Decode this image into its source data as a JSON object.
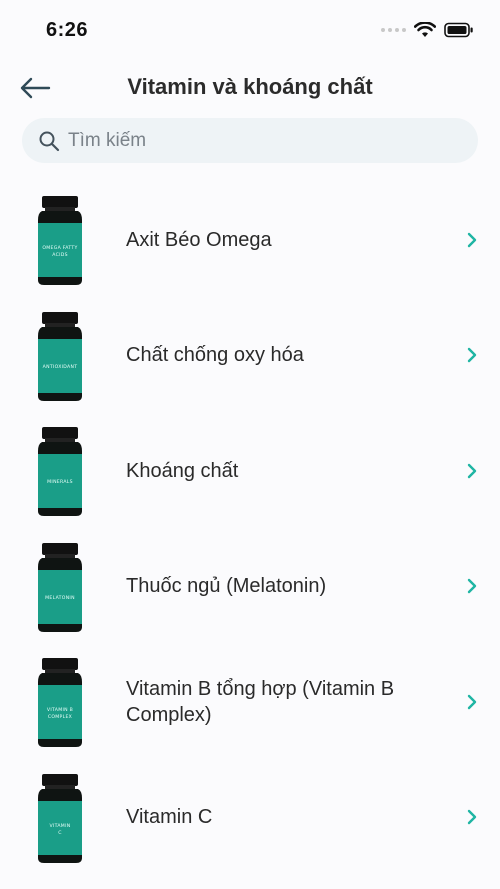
{
  "status": {
    "time": "6:26"
  },
  "header": {
    "title": "Vitamin và khoáng chất"
  },
  "search": {
    "placeholder": "Tìm kiếm"
  },
  "items": [
    {
      "label": "Axit Béo Omega",
      "bottle_text": "OMEGA FATTY ACIDS"
    },
    {
      "label": "Chất chống oxy hóa",
      "bottle_text": "ANTIOXIDANT"
    },
    {
      "label": "Khoáng chất",
      "bottle_text": "MINERALS"
    },
    {
      "label": "Thuốc ngủ (Melatonin)",
      "bottle_text": "MELATONIN"
    },
    {
      "label": "Vitamin B tổng hợp (Vitamin B Complex)",
      "bottle_text": "VITAMIN B COMPLEX"
    },
    {
      "label": "Vitamin C",
      "bottle_text": "VITAMIN C"
    }
  ],
  "colors": {
    "accent": "#1fb5a3",
    "bottle_label": "#1a9e88",
    "bottle_cap": "#111111"
  }
}
